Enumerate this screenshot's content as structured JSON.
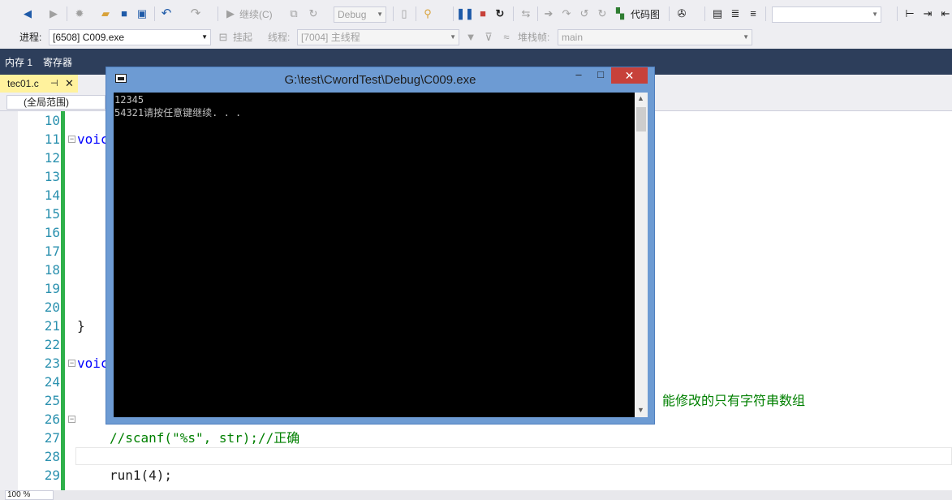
{
  "toolbar1": {
    "continue_label": "继续(C)",
    "config_value": "Debug",
    "codemap_label": "代码图"
  },
  "toolbar2": {
    "process_label": "进程:",
    "process_value": "[6508] C009.exe",
    "suspend_label": "挂起",
    "thread_label": "线程:",
    "thread_value": "[7004] 主线程",
    "stackframe_label": "堆栈帧:",
    "stackframe_value": "main"
  },
  "debug_tabs": [
    "内存 1",
    "寄存器"
  ],
  "file_tab": "tec01.c",
  "scope": "(全局范围)",
  "line_numbers": [
    "10",
    "11",
    "12",
    "13",
    "14",
    "15",
    "16",
    "17",
    "18",
    "19",
    "20",
    "21",
    "22",
    "23",
    "24",
    "25",
    "26",
    "27",
    "28",
    "29"
  ],
  "code": {
    "l11": "voic",
    "l21": "}",
    "l23": "voic",
    "l25_comment": "能修改的只有字符串数组",
    "l27": "//scanf(\"%s\", str);//正确",
    "l29": "run1(4);"
  },
  "zoom": "100 %",
  "console_window": {
    "title": "G:\\test\\CwordTest\\Debug\\C009.exe",
    "lines": [
      "12345",
      "54321请按任意键继续. . ."
    ]
  }
}
